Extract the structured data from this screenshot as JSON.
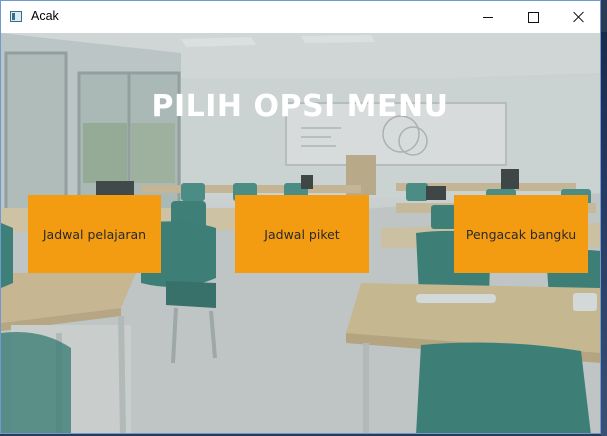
{
  "window": {
    "title": "Acak",
    "icon": "app-window-icon",
    "controls": [
      "minimize-icon",
      "maximize-icon",
      "close-icon"
    ]
  },
  "main": {
    "title": "PILIH OPSI MENU",
    "buttons": [
      {
        "label": "Jadwal pelajaran"
      },
      {
        "label": "Jadwal piket"
      },
      {
        "label": "Pengacak bangku"
      }
    ]
  },
  "colors": {
    "button_bg": "#f39c12",
    "title_text": "#ffffff",
    "seat_teal": "#2e7d74",
    "desk_wood": "#d9c39a"
  }
}
